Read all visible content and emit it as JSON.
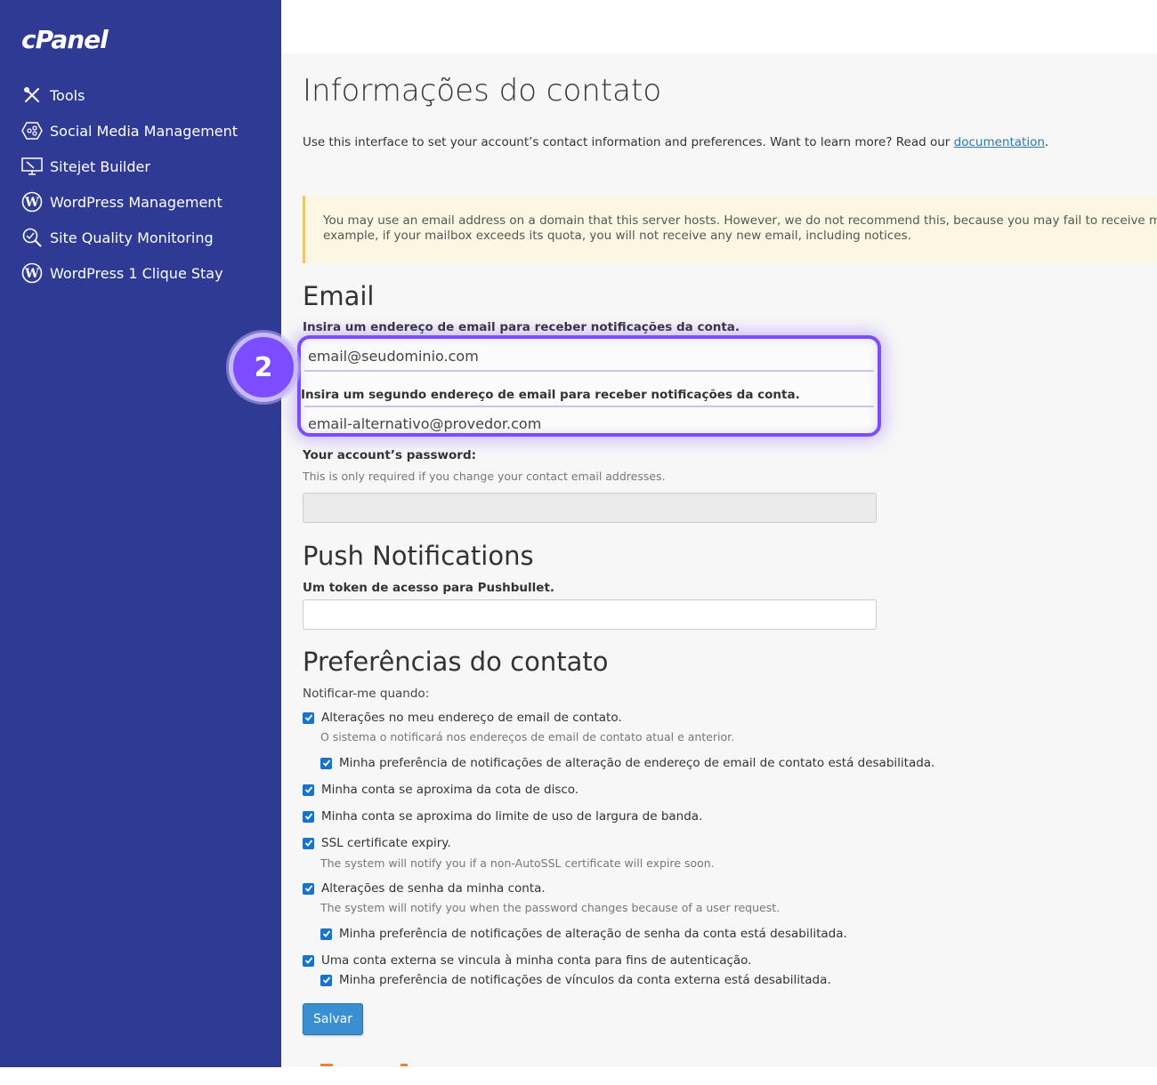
{
  "sidebar": {
    "logo": "cPanel",
    "items": [
      {
        "label": "Tools",
        "icon": "tools-icon"
      },
      {
        "label": "Social Media Management",
        "icon": "social-media-icon"
      },
      {
        "label": "Sitejet Builder",
        "icon": "sitejet-icon"
      },
      {
        "label": "WordPress Management",
        "icon": "wordpress-icon"
      },
      {
        "label": "Site Quality Monitoring",
        "icon": "site-quality-icon"
      },
      {
        "label": "WordPress 1 Clique Stay",
        "icon": "wordpress-icon"
      }
    ]
  },
  "page": {
    "title": "Informações do contato",
    "intro": "Use this interface to set your account’s contact information and preferences. Want to learn more? Read our ",
    "intro_link": "documentation",
    "intro_end": ".",
    "alert_line1": "You may use an email address on a domain that this server hosts. However, we do not recommend this, because you may fail to receive messages. For",
    "alert_line2": "example, if your mailbox exceeds its quota, you will not receive any new email, including notices."
  },
  "email": {
    "heading": "Email",
    "label1": "Insira um endereço de email para receber notificações da conta.",
    "value1": "email@seudominio.com",
    "label2": "Insira um segundo endereço de email para receber notificações da conta.",
    "value2": "email-alternativo@provedor.com",
    "step_number": "2"
  },
  "password": {
    "label": "Your account’s password:",
    "hint": "This is only required if you change your contact email addresses.",
    "value": ""
  },
  "push": {
    "heading": "Push Notifications",
    "label": "Um token de acesso para Pushbullet.",
    "value": ""
  },
  "prefs": {
    "heading": "Preferências do contato",
    "notify_label": "Notificar-me quando:",
    "items": [
      {
        "label": "Alterações no meu endereço de email de contato.",
        "checked": true
      },
      {
        "label": "O sistema o notificará nos endereços de email de contato atual e anterior."
      },
      {
        "label": "Minha preferência de notificações de alteração de endereço de email de contato está desabilitada.",
        "checked": true
      },
      {
        "label": "Minha conta se aproxima da cota de disco.",
        "checked": true
      },
      {
        "label": "Minha conta se aproxima do limite de uso de largura de banda.",
        "checked": true
      },
      {
        "label": "SSL certificate expiry.",
        "checked": true
      },
      {
        "label": "The system will notify you if a non-AutoSSL certificate will expire soon."
      },
      {
        "label": "Alterações de senha da minha conta.",
        "checked": true
      },
      {
        "label": "The system will notify you when the password changes because of a user request."
      },
      {
        "label": "Minha preferência de notificações de alteração de senha da conta está desabilitada.",
        "checked": true
      },
      {
        "label": "Uma conta externa se vincula à minha conta para fins de autenticação.",
        "checked": true
      },
      {
        "label": "Minha preferência de notificações de vínculos da conta externa está desabilitada.",
        "checked": true
      }
    ],
    "save_label": "Salvar"
  },
  "colors": {
    "sidebar": "#2f3a94",
    "highlight": "#7b4dff",
    "checkbox": "#1a73c8",
    "button": "#3a8fd0"
  }
}
